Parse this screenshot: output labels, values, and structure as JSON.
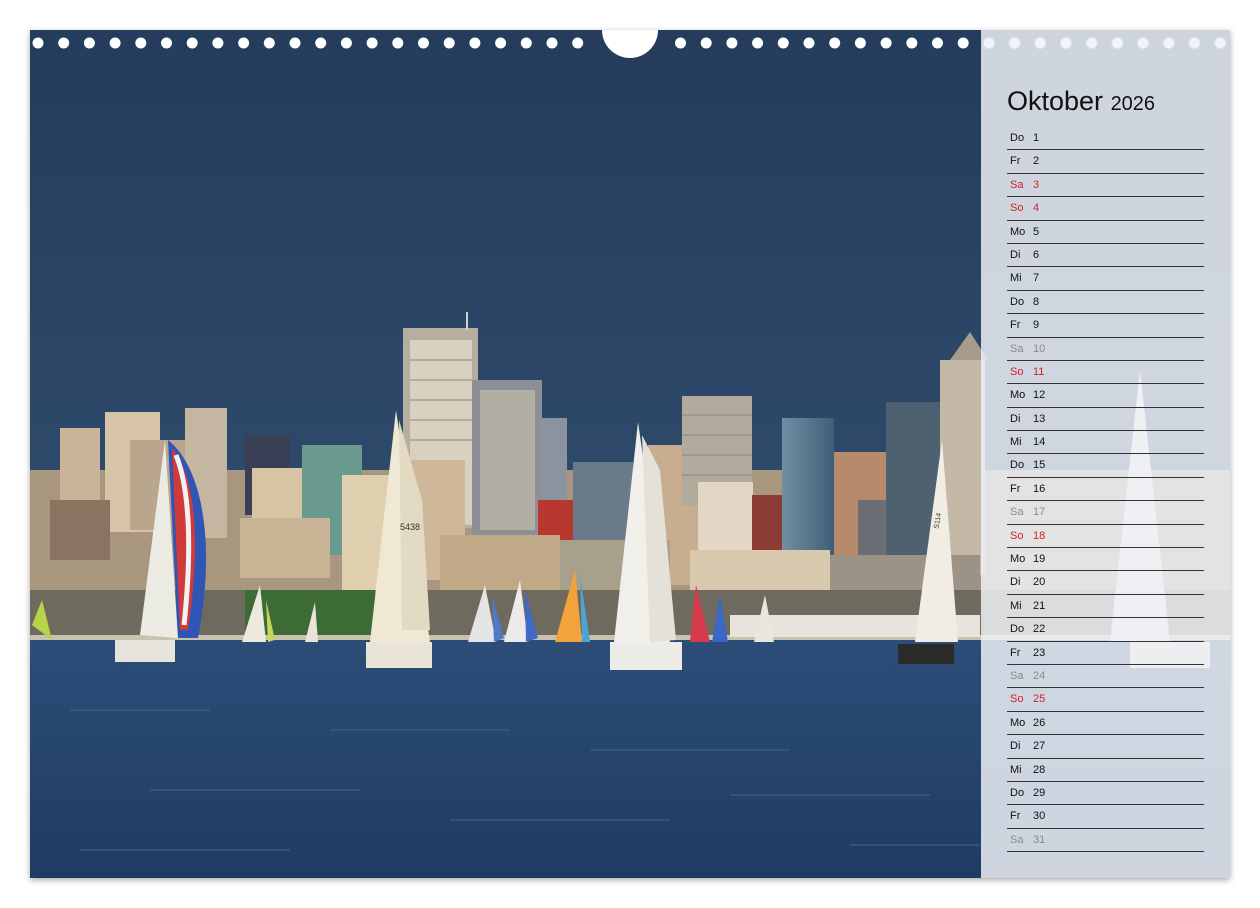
{
  "calendar": {
    "month": "Oktober",
    "year": "2026",
    "days": [
      {
        "dn": "Do",
        "d": "1",
        "type": "normal"
      },
      {
        "dn": "Fr",
        "d": "2",
        "type": "normal"
      },
      {
        "dn": "Sa",
        "d": "3",
        "type": "red"
      },
      {
        "dn": "So",
        "d": "4",
        "type": "red"
      },
      {
        "dn": "Mo",
        "d": "5",
        "type": "normal"
      },
      {
        "dn": "Di",
        "d": "6",
        "type": "normal"
      },
      {
        "dn": "Mi",
        "d": "7",
        "type": "normal"
      },
      {
        "dn": "Do",
        "d": "8",
        "type": "normal"
      },
      {
        "dn": "Fr",
        "d": "9",
        "type": "normal"
      },
      {
        "dn": "Sa",
        "d": "10",
        "type": "grey"
      },
      {
        "dn": "So",
        "d": "11",
        "type": "red"
      },
      {
        "dn": "Mo",
        "d": "12",
        "type": "normal"
      },
      {
        "dn": "Di",
        "d": "13",
        "type": "normal"
      },
      {
        "dn": "Mi",
        "d": "14",
        "type": "normal"
      },
      {
        "dn": "Do",
        "d": "15",
        "type": "normal"
      },
      {
        "dn": "Fr",
        "d": "16",
        "type": "normal"
      },
      {
        "dn": "Sa",
        "d": "17",
        "type": "grey"
      },
      {
        "dn": "So",
        "d": "18",
        "type": "red"
      },
      {
        "dn": "Mo",
        "d": "19",
        "type": "normal"
      },
      {
        "dn": "Di",
        "d": "20",
        "type": "normal"
      },
      {
        "dn": "Mi",
        "d": "21",
        "type": "normal"
      },
      {
        "dn": "Do",
        "d": "22",
        "type": "normal"
      },
      {
        "dn": "Fr",
        "d": "23",
        "type": "normal"
      },
      {
        "dn": "Sa",
        "d": "24",
        "type": "grey"
      },
      {
        "dn": "So",
        "d": "25",
        "type": "red"
      },
      {
        "dn": "Mo",
        "d": "26",
        "type": "normal"
      },
      {
        "dn": "Di",
        "d": "27",
        "type": "normal"
      },
      {
        "dn": "Mi",
        "d": "28",
        "type": "normal"
      },
      {
        "dn": "Do",
        "d": "29",
        "type": "normal"
      },
      {
        "dn": "Fr",
        "d": "30",
        "type": "normal"
      },
      {
        "dn": "Sa",
        "d": "31",
        "type": "grey"
      }
    ]
  },
  "colors": {
    "sky": "#2d4766",
    "water": "#233f66",
    "sunday": "#d42020",
    "saturday_grey": "#8a8a8a"
  },
  "photo": {
    "boat_labels": [
      "5438",
      "S114"
    ]
  }
}
